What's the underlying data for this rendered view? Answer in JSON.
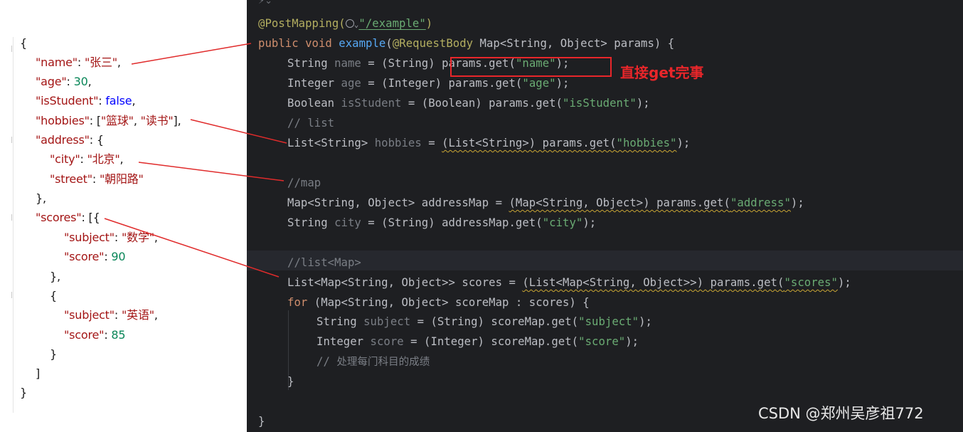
{
  "json_panel": {
    "lines": [
      [
        [
          "p",
          "{"
        ]
      ],
      [
        [
          "k",
          "\"name\""
        ],
        [
          "p",
          ": "
        ],
        [
          "s",
          "\"张三\""
        ],
        [
          "p",
          ","
        ]
      ],
      [
        [
          "k",
          "\"age\""
        ],
        [
          "p",
          ": "
        ],
        [
          "n",
          "30"
        ],
        [
          "p",
          ","
        ]
      ],
      [
        [
          "k",
          "\"isStudent\""
        ],
        [
          "p",
          ": "
        ],
        [
          "b",
          "false"
        ],
        [
          "p",
          ","
        ]
      ],
      [
        [
          "k",
          "\"hobbies\""
        ],
        [
          "p",
          ": ["
        ],
        [
          "s",
          "\"篮球\""
        ],
        [
          "p",
          ", "
        ],
        [
          "s",
          "\"读书\""
        ],
        [
          "p",
          "],"
        ]
      ],
      [
        [
          "k",
          "\"address\""
        ],
        [
          "p",
          ": {"
        ]
      ],
      [
        [
          "k",
          "\"city\""
        ],
        [
          "p",
          ": "
        ],
        [
          "s",
          "\"北京\""
        ],
        [
          "p",
          ","
        ]
      ],
      [
        [
          "k",
          "\"street\""
        ],
        [
          "p",
          ": "
        ],
        [
          "s",
          "\"朝阳路\""
        ]
      ],
      [
        [
          "p",
          "},"
        ]
      ],
      [
        [
          "k",
          "\"scores\""
        ],
        [
          "p",
          ": [{"
        ]
      ],
      [
        [
          "k",
          "\"subject\""
        ],
        [
          "p",
          ": "
        ],
        [
          "s",
          "\"数学\""
        ],
        [
          "p",
          ","
        ]
      ],
      [
        [
          "k",
          "\"score\""
        ],
        [
          "p",
          ": "
        ],
        [
          "n",
          "90"
        ]
      ],
      [
        [
          "p",
          "},"
        ]
      ],
      [
        [
          "p",
          "{"
        ]
      ],
      [
        [
          "k",
          "\"subject\""
        ],
        [
          "p",
          ": "
        ],
        [
          "s",
          "\"英语\""
        ],
        [
          "p",
          ","
        ]
      ],
      [
        [
          "k",
          "\"score\""
        ],
        [
          "p",
          ": "
        ],
        [
          "n",
          "85"
        ]
      ],
      [
        [
          "p",
          "}"
        ]
      ],
      [
        [
          "p",
          "]"
        ]
      ],
      [
        [
          "p",
          "}"
        ]
      ]
    ]
  },
  "code_panel": {
    "lines": [
      [
        [
          "ann",
          "@PostMapping("
        ],
        [
          "icon",
          "globe"
        ],
        [
          "ann",
          ")"
        ]
      ],
      [
        [
          "kw",
          "public "
        ],
        [
          "kw",
          "void "
        ],
        [
          "fn",
          "example"
        ],
        [
          "t",
          "("
        ],
        [
          "ann",
          "@RequestBody "
        ],
        [
          "t",
          "Map<String, Object> params) {"
        ]
      ],
      [
        [
          "t",
          "String "
        ],
        [
          "var",
          "name"
        ],
        [
          "t",
          " = (String) params.get("
        ],
        [
          "str",
          "\"name\""
        ],
        [
          "t",
          ");"
        ]
      ],
      [
        [
          "t",
          "Integer "
        ],
        [
          "var",
          "age"
        ],
        [
          "t",
          " = (Integer) params.get("
        ],
        [
          "str",
          "\"age\""
        ],
        [
          "t",
          ");"
        ]
      ],
      [
        [
          "t",
          "Boolean "
        ],
        [
          "var",
          "isStudent"
        ],
        [
          "t",
          " = (Boolean) params.get("
        ],
        [
          "str",
          "\"isStudent\""
        ],
        [
          "t",
          ");"
        ]
      ],
      [
        [
          "cm",
          "// list"
        ]
      ],
      [
        [
          "t",
          "List<String> "
        ],
        [
          "var",
          "hobbies"
        ],
        [
          "t",
          " = "
        ],
        [
          "sq",
          "(List<String>) params.get("
        ],
        [
          "sqs",
          "\"hobbies\""
        ],
        [
          "t",
          ");"
        ]
      ],
      [
        [
          "t",
          ""
        ]
      ],
      [
        [
          "cm",
          "//map"
        ]
      ],
      [
        [
          "t",
          "Map<String, Object> addressMap = "
        ],
        [
          "sq",
          "(Map<String, Object>) params.get("
        ],
        [
          "sqs",
          "\"address\""
        ],
        [
          "t",
          ");"
        ]
      ],
      [
        [
          "t",
          "String "
        ],
        [
          "var",
          "city"
        ],
        [
          "t",
          " = (String) addressMap.get("
        ],
        [
          "str",
          "\"city\""
        ],
        [
          "t",
          ");"
        ]
      ],
      [
        [
          "t",
          ""
        ]
      ],
      [
        [
          "cm",
          "//list<Map>"
        ]
      ],
      [
        [
          "t",
          "List<Map<String, Object>> scores = "
        ],
        [
          "sq",
          "(List<Map<String, Object>>) params.get("
        ],
        [
          "sqs",
          "\"scores\""
        ],
        [
          "t",
          ");"
        ]
      ],
      [
        [
          "kw",
          "for "
        ],
        [
          "t",
          "(Map<String, Object> scoreMap : scores) {"
        ]
      ],
      [
        [
          "t",
          "String "
        ],
        [
          "var",
          "subject"
        ],
        [
          "t",
          " = (String) scoreMap.get("
        ],
        [
          "str",
          "\"subject\""
        ],
        [
          "t",
          ");"
        ]
      ],
      [
        [
          "t",
          "Integer "
        ],
        [
          "var",
          "score"
        ],
        [
          "t",
          " = (Integer) scoreMap.get("
        ],
        [
          "str",
          "\"score\""
        ],
        [
          "t",
          ");"
        ]
      ],
      [
        [
          "cm",
          "// "
        ],
        [
          "cmz",
          "处理每门科目的成绩"
        ]
      ],
      [
        [
          "t",
          "}"
        ]
      ],
      [
        [
          "t",
          ""
        ]
      ],
      [
        [
          "t",
          "}"
        ]
      ]
    ],
    "mapping_path": "\"/example\"",
    "callout_label": "直接get完事"
  },
  "watermark": "CSDN @郑州吴彦祖772",
  "colors": {
    "editor_bg": "#1e1f22",
    "callout_red": "#e8262a",
    "json_key": "#a31515",
    "json_number": "#098658",
    "json_bool": "#0000ff"
  }
}
